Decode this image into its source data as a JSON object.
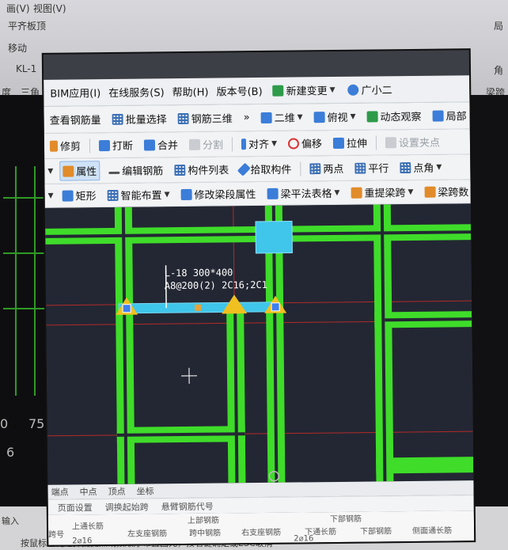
{
  "background": {
    "top_left_items": [
      "画(V)",
      "视图(V)",
      "平齐板顶",
      "移动",
      "KL-1",
      "度",
      "三角"
    ],
    "right_items": [
      "局",
      "角",
      "梁跨"
    ],
    "left_numbers": [
      "0",
      "75",
      "6"
    ],
    "bottom_left": [
      "输入"
    ],
    "bottom_caption": "按鼠标左键选择捕捉点或按顺序布置图元，按右键确定或ESC取消"
  },
  "menubar": {
    "items": [
      "BIM应用(I)",
      "在线服务(S)",
      "帮助(H)",
      "版本号(B)",
      "新建变更",
      "广小二"
    ]
  },
  "toolbar1": {
    "items": [
      "查看钢筋量",
      "批量选择",
      "钢筋三维",
      "»",
      "二维",
      "俯视",
      "动态观察",
      "局部"
    ]
  },
  "toolbar2": {
    "items": [
      "修剪",
      "打断",
      "合并",
      "分割",
      "对齐",
      "偏移",
      "拉伸",
      "设置夹点"
    ]
  },
  "toolbar3": {
    "items": [
      "属性",
      "编辑钢筋",
      "构件列表",
      "拾取构件",
      "两点",
      "平行",
      "点角"
    ]
  },
  "toolbar4": {
    "items": [
      "矩形",
      "智能布置",
      "修改梁段属性",
      "梁平法表格",
      "重提梁跨",
      "梁跨数"
    ]
  },
  "canvas": {
    "beam_label_line1": "L-18 300*400",
    "beam_label_line2": "A8@200(2) 2C16;2C1"
  },
  "snapbar": {
    "items": [
      "端点",
      "中点",
      "顶点",
      "坐标"
    ]
  },
  "lowerbar": {
    "items": [
      "页面设置",
      "调换起始跨",
      "悬臂钢筋代号"
    ]
  },
  "table": {
    "top_heading": "上部钢筋",
    "bottom_heading": "下部钢筋",
    "cols": [
      "上通长筋",
      "左支座钢筋",
      "跨中钢筋",
      "右支座钢筋",
      "下通长筋",
      "下部钢筋",
      "侧面通长筋"
    ],
    "val1": "2⌀16",
    "val2": "2⌀16",
    "row_first": "跨号"
  },
  "colors": {
    "wall_green": "#3fdc2a",
    "beam_cyan": "#3fc6ea",
    "marker_yellow": "#f0c020",
    "grid_red": "#b22a2a"
  }
}
